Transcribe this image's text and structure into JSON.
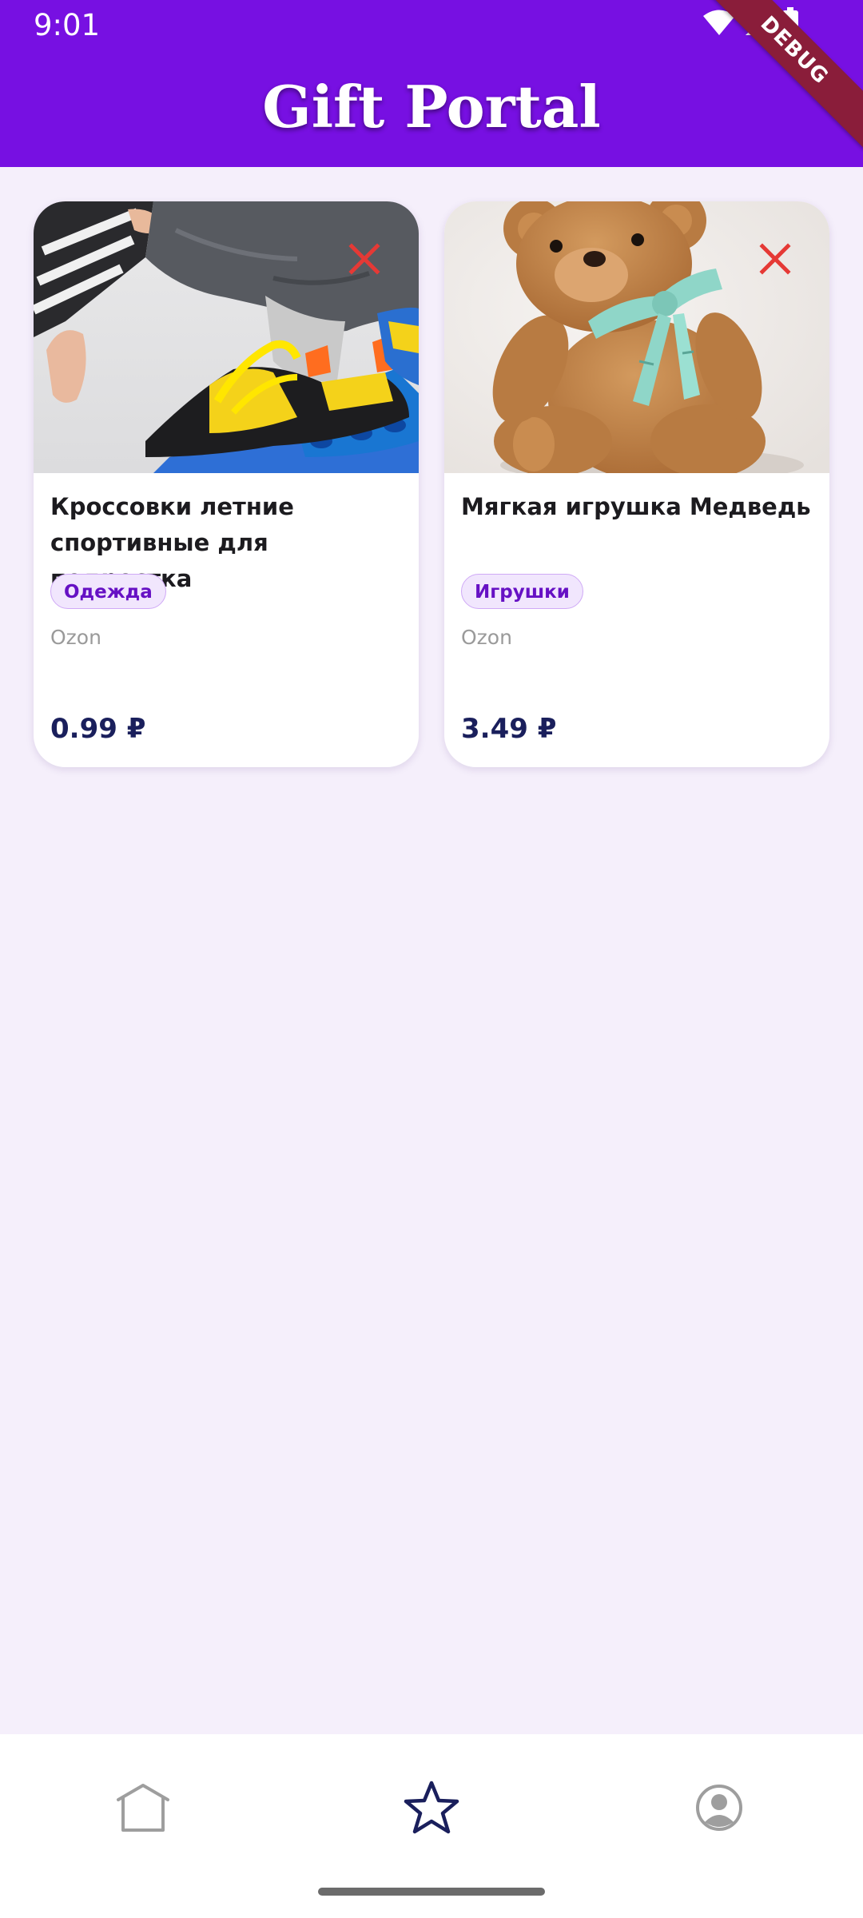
{
  "status_bar": {
    "time": "9:01"
  },
  "header": {
    "title": "Gift Portal",
    "debug_banner": "DEBUG"
  },
  "gifts": [
    {
      "title": "Кроссовки летние спортивные для подростка",
      "category": "Одежда",
      "store": "Ozon",
      "price": "0.99 ₽",
      "image_subject": "sneakers",
      "remove_icon": "close-icon"
    },
    {
      "title": "Мягкая игрушка Медведь",
      "category": "Игрушки",
      "store": "Ozon",
      "price": "3.49 ₽",
      "image_subject": "teddy-bear",
      "remove_icon": "close-icon"
    }
  ],
  "bottom_nav": {
    "items": [
      {
        "icon": "home-icon",
        "active": false
      },
      {
        "icon": "star-icon",
        "active": true
      },
      {
        "icon": "profile-icon",
        "active": false
      }
    ]
  },
  "colors": {
    "header_bg": "#7710e2",
    "page_bg": "#f5effb",
    "chip_bg": "#f1e6fd",
    "chip_text": "#6611c4",
    "price_text": "#1a1f5c",
    "remove_icon": "#e53935",
    "nav_active": "#1a1f5c",
    "nav_inactive": "#9e9e9e"
  }
}
